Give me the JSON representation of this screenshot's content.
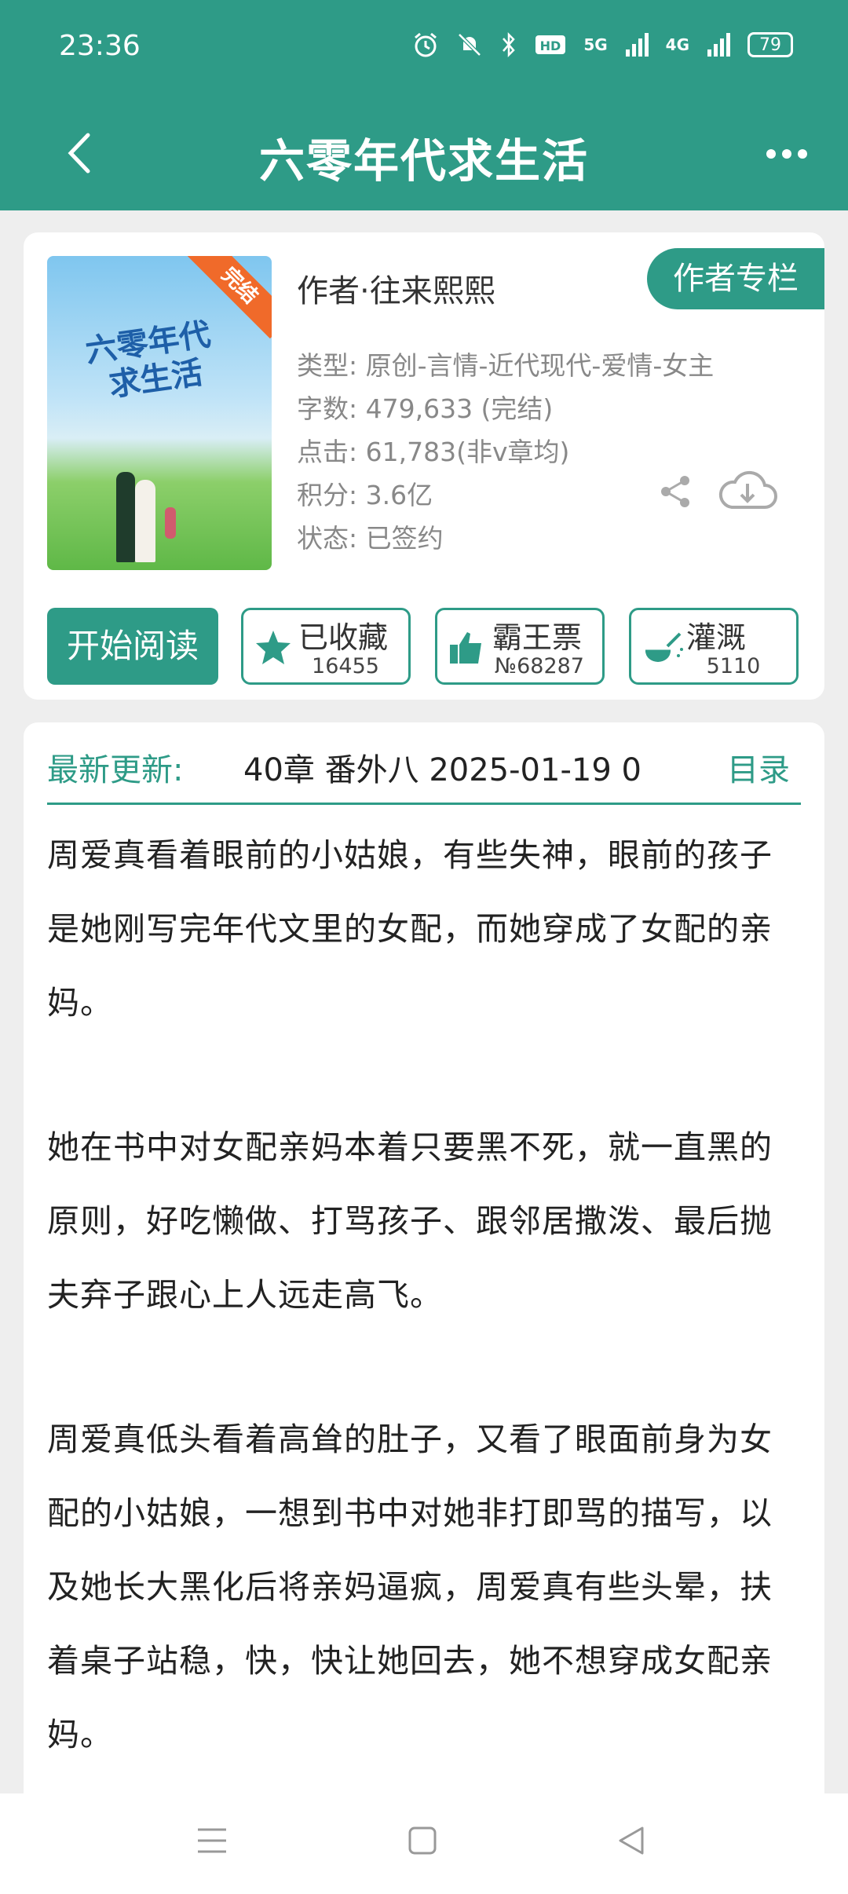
{
  "status_bar": {
    "time": "23:36",
    "network_1": "5G",
    "network_2": "4G",
    "battery": "79",
    "icons": [
      "alarm-icon",
      "mute-icon",
      "bluetooth-icon",
      "hd-icon",
      "signal-icon",
      "signal-icon",
      "battery-icon"
    ]
  },
  "app_bar": {
    "title": "六零年代求生活",
    "back_icon": "back-arrow-icon",
    "more_icon": "more-dots-icon"
  },
  "book": {
    "cover_title_line1": "六零年代",
    "cover_title_line2": "求生活",
    "cover_badge": "完结",
    "author": "作者·往来熙熙",
    "author_column_button": "作者专栏",
    "type": "类型: 原创-言情-近代现代-爱情-女主",
    "word_count": "字数: 479,633 (完结)",
    "clicks": "点击: 61,783(非v章均)",
    "points": "积分: 3.6亿",
    "status": "状态: 已签约"
  },
  "actions": {
    "start_reading": "开始阅读",
    "collect": {
      "label": "已收藏",
      "count": "16455"
    },
    "ticket": {
      "label": "霸王票",
      "count": "№68287"
    },
    "irrigate": {
      "label": "灌溉",
      "count": "5110"
    }
  },
  "latest": {
    "label": "最新更新:",
    "text": "40章  番外八  2025-01-19 0",
    "catalog": "目录"
  },
  "intro": {
    "p1": "周爱真看着眼前的小姑娘，有些失神，眼前的孩子是她刚写完年代文里的女配，而她穿成了女配的亲妈。",
    "p2": "她在书中对女配亲妈本着只要黑不死，就一直黑的原则，好吃懒做、打骂孩子、跟邻居撒泼、最后抛夫弃子跟心上人远走高飞。",
    "p3": "周爱真低头看着高耸的肚子，又看了眼面前身为女配的小姑娘，一想到书中对她非打即骂的描写，以及她长大黑化后将亲妈逼疯，周爱真有些头晕，扶着桌子站稳，快，快让她回去，她不想穿成女配亲妈。"
  },
  "colors": {
    "primary": "#2e9b87",
    "badge": "#f06a2a"
  }
}
